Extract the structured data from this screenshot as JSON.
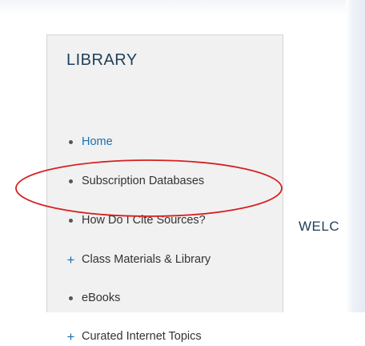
{
  "sidebar": {
    "title": "LIBRARY",
    "items": [
      {
        "label": "Home",
        "marker": "bullet",
        "active": true
      },
      {
        "label": "Subscription Databases",
        "marker": "bullet",
        "active": false
      },
      {
        "label": "How Do I Cite Sources?",
        "marker": "bullet",
        "active": false
      },
      {
        "label": "Class Materials & Library",
        "marker": "plus",
        "active": false
      },
      {
        "label": "eBooks",
        "marker": "bullet",
        "active": false
      },
      {
        "label": "Curated Internet Topics",
        "marker": "plus",
        "active": false
      }
    ]
  },
  "main": {
    "welcome_text": "WELC"
  },
  "annotation": {
    "shape": "ellipse",
    "color": "#d62020",
    "target": "How Do I Cite Sources?"
  },
  "colors": {
    "link": "#1a6fb0",
    "heading": "#1e3f5a",
    "text": "#333333",
    "sidebar_bg": "#f1f1f1"
  }
}
